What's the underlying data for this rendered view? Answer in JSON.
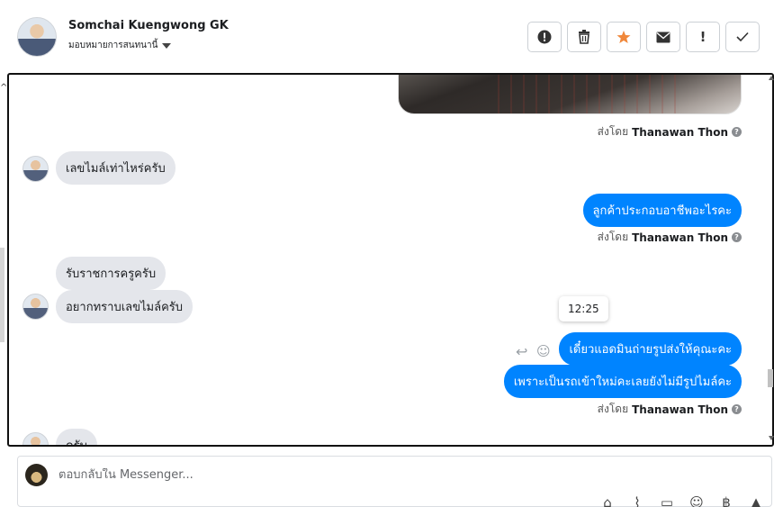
{
  "header": {
    "contact_name": "Somchai Kuengwong GK",
    "assign_label": "มอบหมายการสนทนานี้"
  },
  "actions": [
    {
      "name": "alert",
      "glyph": "!",
      "icon": "exclamation-circle-icon"
    },
    {
      "name": "trash",
      "glyph": "🗑",
      "icon": "trash-icon"
    },
    {
      "name": "star",
      "glyph": "★",
      "icon": "star-icon"
    },
    {
      "name": "mail",
      "glyph": "✉",
      "icon": "envelope-icon"
    },
    {
      "name": "mark",
      "glyph": "!",
      "icon": "exclamation-icon"
    },
    {
      "name": "done",
      "glyph": "✓",
      "icon": "check-icon"
    }
  ],
  "conversation": {
    "sent_by_prefix": "ส่งโดย",
    "sender": "Thanawan Thon",
    "messages": [
      {
        "dir": "in",
        "text": "เลขไมล์เท่าไหร่ครับ"
      },
      {
        "dir": "out",
        "text": "ลูกค้าประกอบอาชีพอะไรคะ"
      },
      {
        "dir": "in",
        "text": "รับราชการครูครับ"
      },
      {
        "dir": "in",
        "text": "อยากทราบเลขไมล์ครับ"
      },
      {
        "dir": "out",
        "text": "เดี๋ยวแอดมินถ่ายรูปส่งให้คุณะคะ"
      },
      {
        "dir": "out",
        "text": "เพราะเป็นรถเข้าใหม่คะเลยยังไม่มีรูปไมล์คะ"
      },
      {
        "dir": "in",
        "text": "ครับ"
      }
    ],
    "time_tooltip": "12:25"
  },
  "composer": {
    "placeholder": "ตอบกลับใน Messenger..."
  },
  "composer_tools": [
    {
      "name": "bag",
      "glyph": "🛍",
      "icon": "shopping-bag-icon"
    },
    {
      "name": "attach",
      "glyph": "📎",
      "icon": "paperclip-icon"
    },
    {
      "name": "saved-reply",
      "glyph": "💬",
      "icon": "saved-reply-icon"
    },
    {
      "name": "emoji",
      "glyph": "☺",
      "icon": "emoji-icon"
    },
    {
      "name": "payment",
      "glyph": "฿",
      "icon": "baht-icon"
    },
    {
      "name": "like",
      "glyph": "👍",
      "icon": "thumbs-up-icon"
    }
  ]
}
